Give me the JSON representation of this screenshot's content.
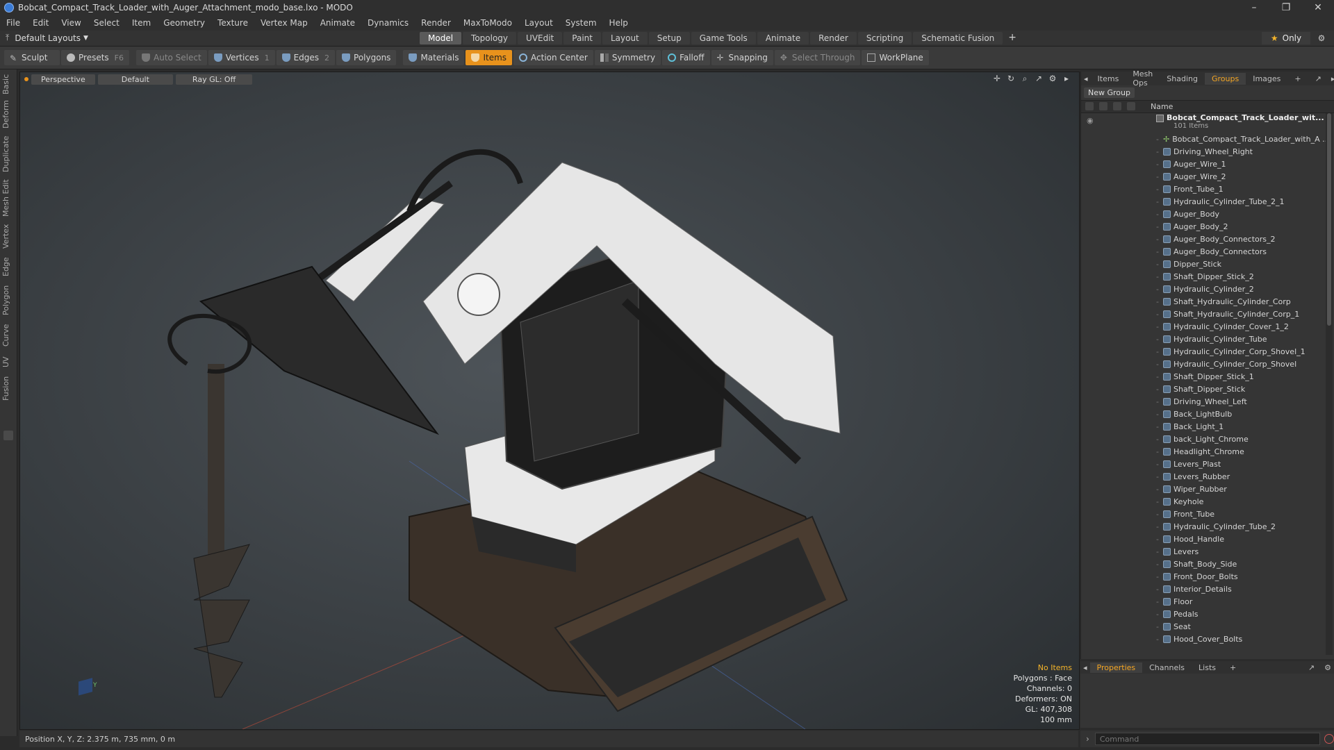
{
  "window": {
    "title": "Bobcat_Compact_Track_Loader_with_Auger_Attachment_modo_base.lxo - MODO"
  },
  "menu": [
    "File",
    "Edit",
    "View",
    "Select",
    "Item",
    "Geometry",
    "Texture",
    "Vertex Map",
    "Animate",
    "Dynamics",
    "Render",
    "MaxToModo",
    "Layout",
    "System",
    "Help"
  ],
  "layouts": {
    "label": "Default Layouts"
  },
  "mode_tabs": [
    "Model",
    "Topology",
    "UVEdit",
    "Paint",
    "Layout",
    "Setup",
    "Game Tools",
    "Animate",
    "Render",
    "Scripting",
    "Schematic Fusion"
  ],
  "active_mode": "Model",
  "only_label": "Only",
  "toolbar": {
    "sculpt": "Sculpt",
    "presets": "Presets",
    "presets_key": "F6",
    "auto_select": "Auto Select",
    "vertices": "Vertices",
    "vertices_key": "1",
    "edges": "Edges",
    "edges_key": "2",
    "polygons": "Polygons",
    "materials": "Materials",
    "items": "Items",
    "action_center": "Action Center",
    "symmetry": "Symmetry",
    "falloff": "Falloff",
    "snapping": "Snapping",
    "select_through": "Select Through",
    "workplane": "WorkPlane"
  },
  "left_tabs": [
    "Basic",
    "Deform",
    "Duplicate",
    "Mesh Edit",
    "Vertex",
    "Edge",
    "Polygon",
    "Curve",
    "UV",
    "Fusion"
  ],
  "viewport": {
    "view": "Perspective",
    "style": "Default",
    "raygl": "Ray GL: Off",
    "info": {
      "items": "No Items",
      "polygons": "Polygons : Face",
      "channels": "Channels: 0",
      "deformers": "Deformers: ON",
      "gl": "GL: 407,308",
      "scale": "100 mm"
    },
    "colors": {
      "accent": "#e8921c",
      "warning": "#f5b42a"
    }
  },
  "status": {
    "position": "Position X, Y, Z:   2.375 m, 735 mm, 0 m"
  },
  "right_tabs": [
    "Items",
    "Mesh Ops",
    "Shading",
    "Groups",
    "Images"
  ],
  "active_right_tab": "Groups",
  "new_group": "New Group",
  "column_name": "Name",
  "group": {
    "name": "Bobcat_Compact_Track_Loader_wit...",
    "count": "101 Items"
  },
  "items": [
    "Bobcat_Compact_Track_Loader_with_A ...",
    "Driving_Wheel_Right",
    "Auger_Wire_1",
    "Auger_Wire_2",
    "Front_Tube_1",
    "Hydraulic_Cylinder_Tube_2_1",
    "Auger_Body",
    "Auger_Body_2",
    "Auger_Body_Connectors_2",
    "Auger_Body_Connectors",
    "Dipper_Stick",
    "Shaft_Dipper_Stick_2",
    "Hydraulic_Cylinder_2",
    "Shaft_Hydraulic_Cylinder_Corp",
    "Shaft_Hydraulic_Cylinder_Corp_1",
    "Hydraulic_Cylinder_Cover_1_2",
    "Hydraulic_Cylinder_Tube",
    "Hydraulic_Cylinder_Corp_Shovel_1",
    "Hydraulic_Cylinder_Corp_Shovel",
    "Shaft_Dipper_Stick_1",
    "Shaft_Dipper_Stick",
    "Driving_Wheel_Left",
    "Back_LightBulb",
    "Back_Light_1",
    "back_Light_Chrome",
    "Headlight_Chrome",
    "Levers_Plast",
    "Levers_Rubber",
    "Wiper_Rubber",
    "Keyhole",
    "Front_Tube",
    "Hydraulic_Cylinder_Tube_2",
    "Hood_Handle",
    "Levers",
    "Shaft_Body_Side",
    "Front_Door_Bolts",
    "Interior_Details",
    "Floor",
    "Pedals",
    "Seat",
    "Hood_Cover_Bolts"
  ],
  "bottom_tabs": [
    "Properties",
    "Channels",
    "Lists"
  ],
  "active_bottom_tab": "Properties",
  "command": {
    "placeholder": "Command"
  }
}
